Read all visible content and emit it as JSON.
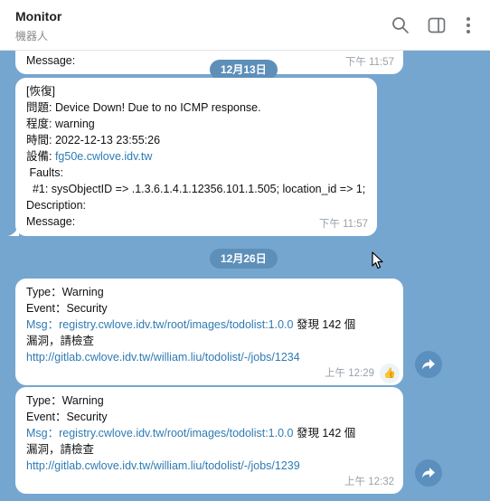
{
  "header": {
    "title": "Monitor",
    "subtitle": "機器人"
  },
  "colors": {
    "chat_background": "#75a6cf",
    "bubble": "#ffffff",
    "link": "#2e7bb3",
    "date_pill": "#5d8fb9"
  },
  "messages": {
    "m0": {
      "lines": [
        "Message:"
      ],
      "time": "下午 11:57"
    },
    "date1": "12月13日",
    "m1": {
      "lines": [
        "[恢復]",
        "問題: Device Down! Due to no ICMP response.",
        "程度: warning",
        "時間: 2022-12-13 23:55:26"
      ],
      "device_label": "設備: ",
      "device_link": "fg50e.cwlove.idv.tw",
      "faults_label": " Faults:",
      "fault_line": "  #1: sysObjectID => .1.3.6.1.4.1.12356.101.1.505; location_id => 1;",
      "description": "Description:",
      "message": "Message:",
      "time": "下午 11:57"
    },
    "date2": "12月26日",
    "m2": {
      "type": "Type：Warning",
      "event": "Event：Security",
      "msg_link": "Msg：registry.cwlove.idv.tw/root/images/todolist:1.0.0",
      "msg_suffix": " 發現 142 個",
      "msg_line2": "漏洞，請檢查",
      "url": "http://gitlab.cwlove.idv.tw/william.liu/todolist/-/jobs/1234",
      "time": "上午 12:29",
      "reaction": "👍"
    },
    "m3": {
      "type": "Type：Warning",
      "event": "Event：Security",
      "msg_link": "Msg：registry.cwlove.idv.tw/root/images/todolist:1.0.0",
      "msg_suffix": " 發現 142 個",
      "msg_line2": "漏洞，請檢查",
      "url": "http://gitlab.cwlove.idv.tw/william.liu/todolist/-/jobs/1239",
      "time": "上午 12:32"
    }
  }
}
